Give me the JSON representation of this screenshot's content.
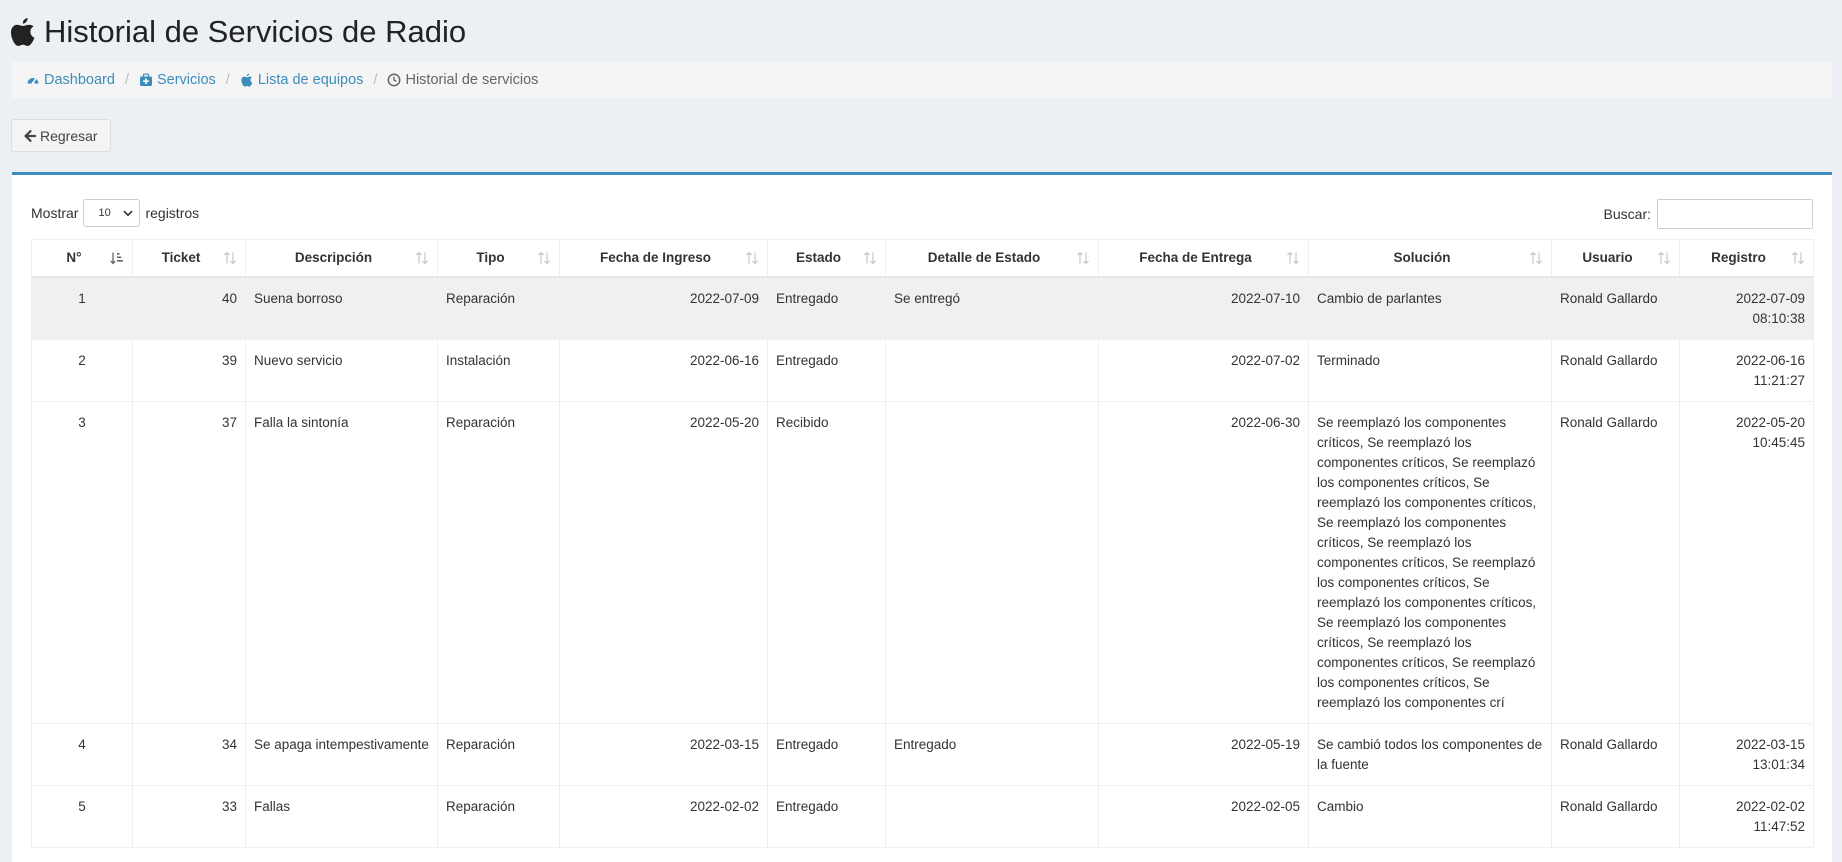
{
  "header": {
    "title": "Historial de Servicios de Radio"
  },
  "breadcrumb": [
    {
      "label": "Dashboard",
      "icon": "dashboard-icon"
    },
    {
      "label": "Servicios",
      "icon": "medkit-icon"
    },
    {
      "label": "Lista de equipos",
      "icon": "apple-icon"
    },
    {
      "label": "Historial de servicios",
      "icon": "clock-icon"
    }
  ],
  "actions": {
    "back_label": "Regresar"
  },
  "table_controls": {
    "show_label": "Mostrar",
    "page_size": "10",
    "records_label": "registros",
    "search_label": "Buscar:",
    "search_value": ""
  },
  "table": {
    "columns": [
      "N°",
      "Ticket",
      "Descripción",
      "Tipo",
      "Fecha de Ingreso",
      "Estado",
      "Detalle de Estado",
      "Fecha de Entrega",
      "Solución",
      "Usuario",
      "Registro"
    ],
    "rows": [
      {
        "n": "1",
        "ticket": "40",
        "descripcion": "Suena borroso",
        "tipo": "Reparación",
        "fecha_ingreso": "2022-07-09",
        "estado": "Entregado",
        "detalle": "Se entregó",
        "fecha_entrega": "2022-07-10",
        "solucion": "Cambio de parlantes",
        "usuario": "Ronald Gallardo",
        "registro_fecha": "2022-07-09",
        "registro_hora": "08:10:38"
      },
      {
        "n": "2",
        "ticket": "39",
        "descripcion": "Nuevo servicio",
        "tipo": "Instalación",
        "fecha_ingreso": "2022-06-16",
        "estado": "Entregado",
        "detalle": "",
        "fecha_entrega": "2022-07-02",
        "solucion": "Terminado",
        "usuario": "Ronald Gallardo",
        "registro_fecha": "2022-06-16",
        "registro_hora": "11:21:27"
      },
      {
        "n": "3",
        "ticket": "37",
        "descripcion": "Falla la sintonía",
        "tipo": "Reparación",
        "fecha_ingreso": "2022-05-20",
        "estado": "Recibido",
        "detalle": "",
        "fecha_entrega": "2022-06-30",
        "solucion": "Se reemplazó los componentes críticos, Se reemplazó los componentes críticos, Se reemplazó los componentes críticos, Se reemplazó los componentes críticos, Se reemplazó los componentes críticos, Se reemplazó los componentes críticos, Se reemplazó los componentes críticos, Se reemplazó los componentes críticos, Se reemplazó los componentes críticos, Se reemplazó los componentes críticos, Se reemplazó los componentes críticos, Se reemplazó los componentes crí",
        "usuario": "Ronald Gallardo",
        "registro_fecha": "2022-05-20",
        "registro_hora": "10:45:45"
      },
      {
        "n": "4",
        "ticket": "34",
        "descripcion": "Se apaga intempestivamente",
        "tipo": "Reparación",
        "fecha_ingreso": "2022-03-15",
        "estado": "Entregado",
        "detalle": "Entregado",
        "fecha_entrega": "2022-05-19",
        "solucion": "Se cambió todos los componentes de la fuente",
        "usuario": "Ronald Gallardo",
        "registro_fecha": "2022-03-15",
        "registro_hora": "13:01:34"
      },
      {
        "n": "5",
        "ticket": "33",
        "descripcion": "Fallas",
        "tipo": "Reparación",
        "fecha_ingreso": "2022-02-02",
        "estado": "Entregado",
        "detalle": "",
        "fecha_entrega": "2022-02-05",
        "solucion": "Cambio",
        "usuario": "Ronald Gallardo",
        "registro_fecha": "2022-02-02",
        "registro_hora": "11:47:52"
      }
    ]
  },
  "colors": {
    "accent": "#3c8dbc",
    "background": "#ecf0f5"
  }
}
